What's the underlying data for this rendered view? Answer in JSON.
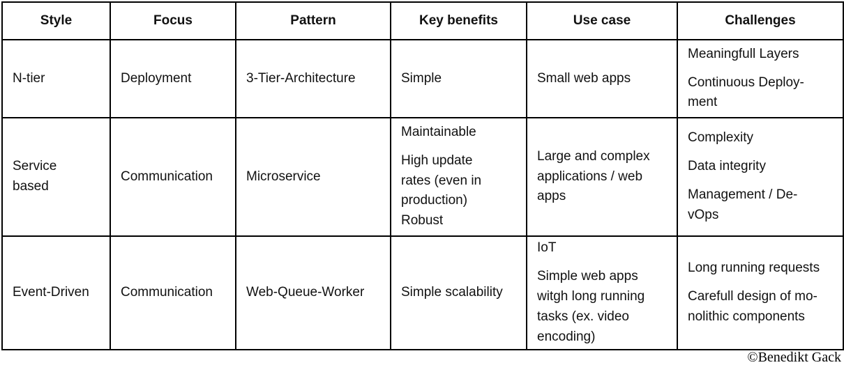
{
  "table": {
    "headers": [
      "Style",
      "Focus",
      "Pattern",
      "Key benefits",
      "Use case",
      "Challenges"
    ],
    "rows": [
      {
        "style": "N-tier",
        "focus": "Deployment",
        "pattern": "3-Tier-Architecture",
        "key_benefits": [
          "Simple"
        ],
        "use_case": [
          "Small web apps"
        ],
        "challenges": [
          "Meaningfull Layers",
          "Continuous Deploy-",
          "ment"
        ]
      },
      {
        "style": [
          "Service",
          "based"
        ],
        "focus": "Communication",
        "pattern": "Microservice",
        "key_benefits": [
          "Maintainable",
          "High update",
          "rates (even in",
          "production)",
          "Robust"
        ],
        "use_case": [
          "Large and complex",
          "applications / web",
          "apps"
        ],
        "challenges": [
          "Complexity",
          "Data integrity",
          "Management / De-",
          "vOps"
        ]
      },
      {
        "style": "Event-Driven",
        "focus": "Communication",
        "pattern": "Web-Queue-Worker",
        "key_benefits": [
          "Simple scalability"
        ],
        "use_case": [
          "IoT",
          "Simple web apps",
          "witgh long running",
          "tasks (ex. video",
          "encoding)"
        ],
        "challenges": [
          "Long running requests",
          "Carefull design of mo-",
          "nolithic components"
        ]
      }
    ]
  },
  "attribution": "©Benedikt Gack"
}
